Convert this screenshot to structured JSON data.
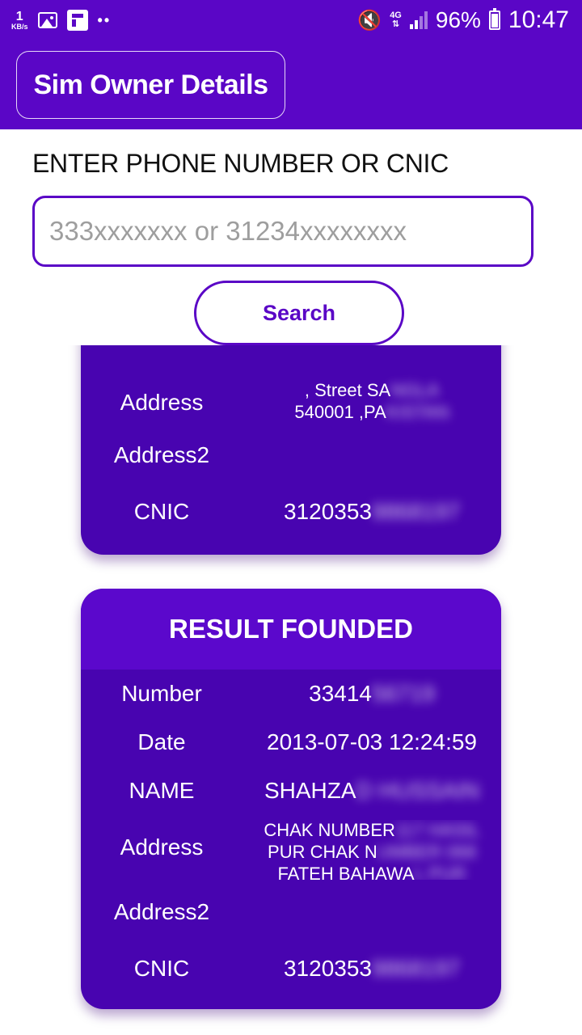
{
  "status_bar": {
    "net_speed_value": "1",
    "net_speed_unit": "KB/s",
    "network_type": "4G",
    "battery": "96%",
    "time": "10:47",
    "icons": [
      "gallery-icon",
      "flipboard-icon",
      "more-dots-icon",
      "mute-icon",
      "signal-icon",
      "battery-icon"
    ]
  },
  "app_bar": {
    "title": "Sim Owner Details"
  },
  "search": {
    "label": "ENTER PHONE NUMBER OR CNIC",
    "placeholder": "333xxxxxxx or 31234xxxxxxxx",
    "value": "",
    "button_label": "Search"
  },
  "results": [
    {
      "rows": [
        {
          "label": "Address",
          "value_line1": ", Street SA",
          "value_line1_hidden": "NGLA",
          "value_line2": "540001 ,PA",
          "value_line2_hidden": "KISTAN"
        },
        {
          "label": "Address2",
          "value": ""
        },
        {
          "label": "CNIC",
          "value": "3120353",
          "value_hidden": "9868197"
        }
      ]
    },
    {
      "header": "RESULT FOUNDED",
      "rows": [
        {
          "label": "Number",
          "value": "33414",
          "value_hidden": "56719"
        },
        {
          "label": "Date",
          "value": "2013-07-03 12:24:59"
        },
        {
          "label": "NAME",
          "value": "SHAHZA",
          "value_hidden": "D HUSSAIN"
        },
        {
          "label": "Address",
          "value_line1": "CHAK NUMBER",
          "value_line1_hidden": " 117 HASIL",
          "value_line2": "PUR CHAK N",
          "value_line2_hidden": "UMBER 068",
          "value_line3": "FATEH BAHAWA",
          "value_line3_hidden": "L PUR"
        },
        {
          "label": "Address2",
          "value": ""
        },
        {
          "label": "CNIC",
          "value": "3120353",
          "value_hidden": "9868197"
        }
      ]
    }
  ],
  "colors": {
    "primary": "#5a06c6",
    "card": "#4804b0",
    "card_header": "#5b08cc"
  }
}
